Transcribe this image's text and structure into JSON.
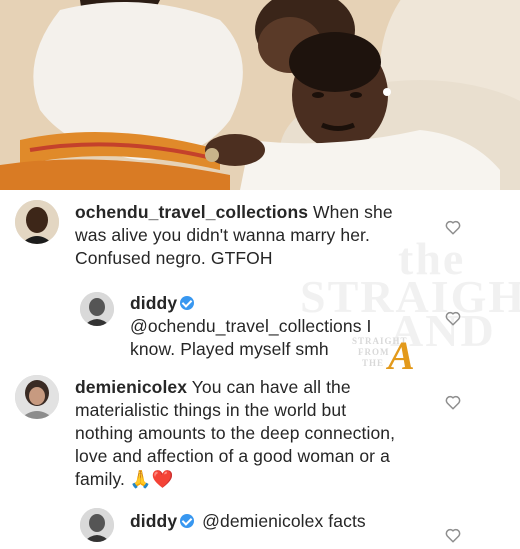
{
  "comments": [
    {
      "username": "ochendu_travel_collections",
      "text_line1": " When she",
      "text_line2": "was alive you didn't wanna marry her.",
      "text_line3": "Confused negro. GTFOH"
    },
    {
      "username": "diddy",
      "verified": true,
      "text_line1": "@ochendu_travel_collections I",
      "text_line2": "know. Played myself smh"
    },
    {
      "username": "demienicolex",
      "text_line1": " You can have all the",
      "text_line2": "materialistic things in the world but",
      "text_line3": "nothing amounts to the deep connection,",
      "text_line4": "love and affection of a good woman or a",
      "text_line5": "family. 🙏❤️"
    },
    {
      "username": "diddy",
      "verified": true,
      "text_line1": "@demienicolex facts"
    }
  ],
  "watermark": {
    "line1": "the",
    "line2": "STRAIGHT",
    "line3": "AND",
    "logo_small1": "STRAIGHT",
    "logo_small2": "FROM",
    "logo_small3": "THE",
    "logo_letter": "A"
  },
  "icons": {
    "like": "heart-outline-icon",
    "verified": "verified-badge-icon"
  },
  "colors": {
    "verified": "#3897f0",
    "text": "#262626",
    "heart_outline": "#8e8e8e",
    "logo_accent": "#e39a1c"
  }
}
